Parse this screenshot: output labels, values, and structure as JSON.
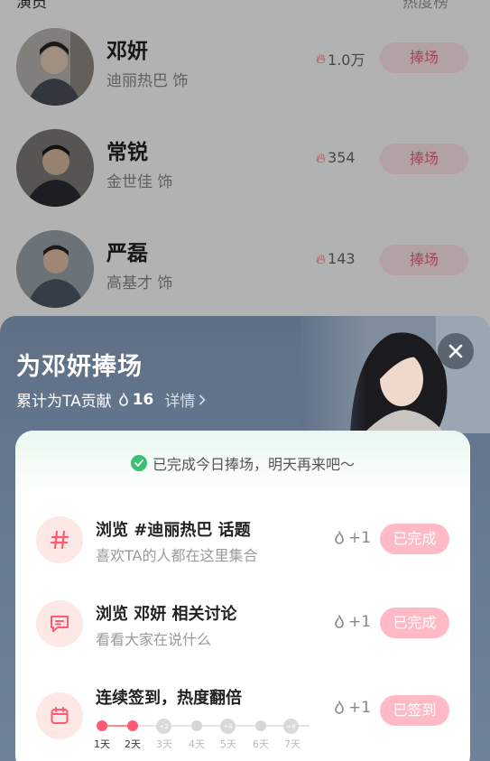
{
  "background": {
    "header_left": "演员",
    "header_right": "热度榜",
    "cast": [
      {
        "name": "邓妍",
        "role": "迪丽热巴 饰",
        "heat": "1.0万",
        "cheer": "捧场"
      },
      {
        "name": "常锐",
        "role": "金世佳 饰",
        "heat": "354",
        "cheer": "捧场"
      },
      {
        "name": "严磊",
        "role": "高基才 饰",
        "heat": "143",
        "cheer": "捧场"
      }
    ]
  },
  "sheet": {
    "title": "为邓妍捧场",
    "contribution_prefix": "累计为TA贡献",
    "contribution_count": "16",
    "detail_label": "详情",
    "status": "已完成今日捧场，明天再来吧～",
    "tasks": [
      {
        "title": "浏览 #迪丽热巴 话题",
        "desc": "喜欢TA的人都在这里集合",
        "reward": "+1",
        "button": "已完成",
        "icon": "hashtag-icon"
      },
      {
        "title": "浏览 邓妍 相关讨论",
        "desc": "看看大家在说什么",
        "reward": "+1",
        "button": "已完成",
        "icon": "comment-icon"
      },
      {
        "title": "连续签到，热度翻倍",
        "desc": "",
        "reward": "+1",
        "button": "已签到",
        "icon": "calendar-icon"
      }
    ],
    "streak": {
      "days": [
        "1天",
        "2天",
        "3天",
        "4天",
        "5天",
        "6天",
        "7天"
      ],
      "bonus": [
        "+2",
        "+4",
        "+8"
      ],
      "completed_days": 2
    }
  },
  "colors": {
    "accent": "#ff5a74",
    "done_button": "#ffbac6",
    "sheet_bg": "#627389",
    "success": "#38c173"
  }
}
